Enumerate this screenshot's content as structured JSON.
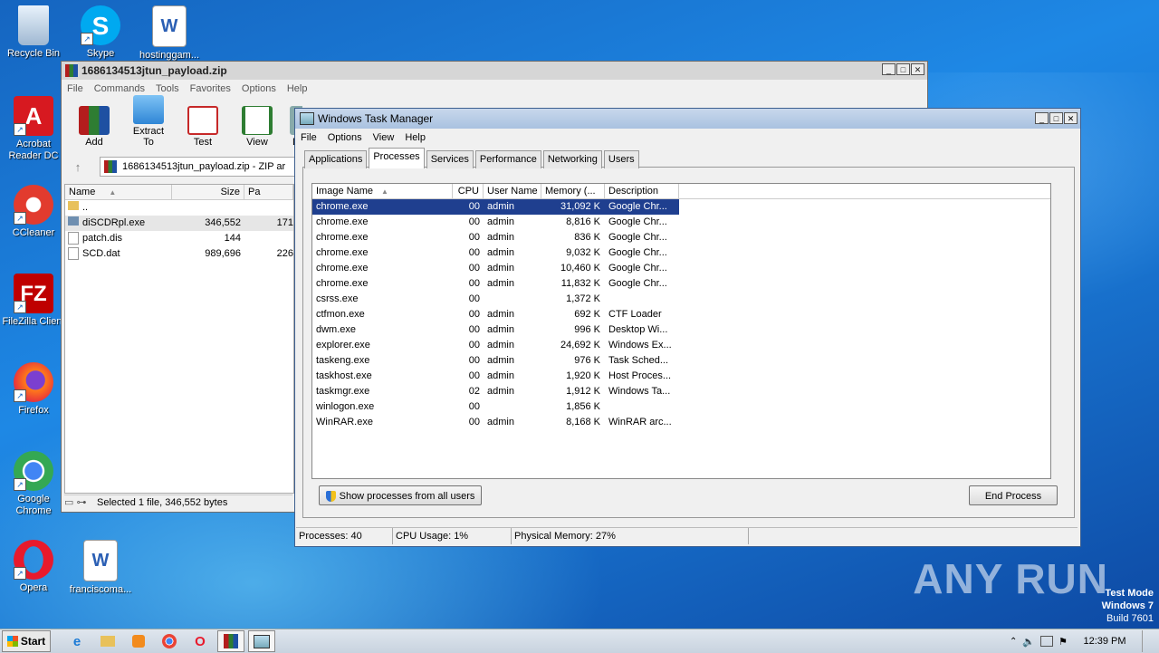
{
  "desktop": {
    "icons": [
      {
        "label": "Recycle Bin",
        "icon": "recycle-bin-icon"
      },
      {
        "label": "Skype",
        "icon": "skype-icon"
      },
      {
        "label": "hostinggam...",
        "icon": "word-doc-icon"
      },
      {
        "label": "Acrobat Reader DC",
        "icon": "acrobat-icon"
      },
      {
        "label": "CCleaner",
        "icon": "ccleaner-icon"
      },
      {
        "label": "FileZilla Client",
        "icon": "filezilla-icon"
      },
      {
        "label": "Firefox",
        "icon": "firefox-icon"
      },
      {
        "label": "Google Chrome",
        "icon": "chrome-icon"
      },
      {
        "label": "Opera",
        "icon": "opera-icon"
      },
      {
        "label": "franciscoma...",
        "icon": "word-doc-icon"
      }
    ],
    "watermark": "ANY RUN",
    "test_mode": [
      "Test Mode",
      "Windows 7",
      "Build 7601"
    ]
  },
  "winrar": {
    "title": "1686134513jtun_payload.zip",
    "menu": [
      "File",
      "Commands",
      "Tools",
      "Favorites",
      "Options",
      "Help"
    ],
    "tools": [
      "Add",
      "Extract To",
      "Test",
      "View",
      "D"
    ],
    "address": "1686134513jtun_payload.zip - ZIP ar",
    "columns": [
      "Name",
      "Size",
      "Pa"
    ],
    "files": [
      {
        "name": "..",
        "size": "",
        "packed": ""
      },
      {
        "name": "diSCDRpl.exe",
        "size": "346,552",
        "packed": "171"
      },
      {
        "name": "patch.dis",
        "size": "144",
        "packed": ""
      },
      {
        "name": "SCD.dat",
        "size": "989,696",
        "packed": "226"
      }
    ],
    "status": "Selected 1 file, 346,552 bytes"
  },
  "taskmgr": {
    "title": "Windows Task Manager",
    "menu": [
      "File",
      "Options",
      "View",
      "Help"
    ],
    "tabs": [
      "Applications",
      "Processes",
      "Services",
      "Performance",
      "Networking",
      "Users"
    ],
    "active_tab": "Processes",
    "columns": [
      "Image Name",
      "CPU",
      "User Name",
      "Memory (...",
      "Description"
    ],
    "processes": [
      [
        "chrome.exe",
        "00",
        "admin",
        "31,092 K",
        "Google Chr..."
      ],
      [
        "chrome.exe",
        "00",
        "admin",
        "8,816 K",
        "Google Chr..."
      ],
      [
        "chrome.exe",
        "00",
        "admin",
        "836 K",
        "Google Chr..."
      ],
      [
        "chrome.exe",
        "00",
        "admin",
        "9,032 K",
        "Google Chr..."
      ],
      [
        "chrome.exe",
        "00",
        "admin",
        "10,460 K",
        "Google Chr..."
      ],
      [
        "chrome.exe",
        "00",
        "admin",
        "11,832 K",
        "Google Chr..."
      ],
      [
        "csrss.exe",
        "00",
        "",
        "1,372 K",
        ""
      ],
      [
        "ctfmon.exe",
        "00",
        "admin",
        "692 K",
        "CTF Loader"
      ],
      [
        "dwm.exe",
        "00",
        "admin",
        "996 K",
        "Desktop Wi..."
      ],
      [
        "explorer.exe",
        "00",
        "admin",
        "24,692 K",
        "Windows Ex..."
      ],
      [
        "taskeng.exe",
        "00",
        "admin",
        "976 K",
        "Task Sched..."
      ],
      [
        "taskhost.exe",
        "00",
        "admin",
        "1,920 K",
        "Host Proces..."
      ],
      [
        "taskmgr.exe",
        "02",
        "admin",
        "1,912 K",
        "Windows Ta..."
      ],
      [
        "winlogon.exe",
        "00",
        "",
        "1,856 K",
        ""
      ],
      [
        "WinRAR.exe",
        "00",
        "admin",
        "8,168 K",
        "WinRAR arc..."
      ]
    ],
    "show_all_label": "Show processes from all users",
    "end_process_label": "End Process",
    "status": {
      "processes": "Processes: 40",
      "cpu": "CPU Usage: 1%",
      "memory": "Physical Memory: 27%"
    }
  },
  "taskbar": {
    "start_label": "Start",
    "clock": "12:39 PM"
  }
}
